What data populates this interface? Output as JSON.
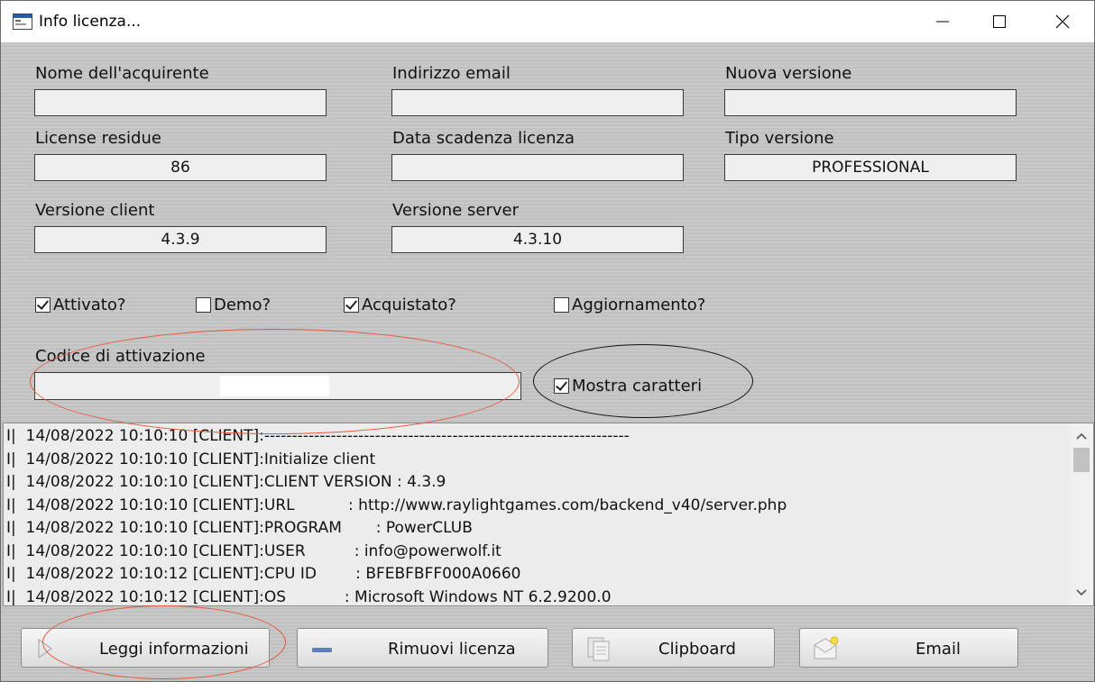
{
  "window": {
    "title": "Info licenza..."
  },
  "fields": {
    "buyer_name": {
      "label": "Nome dell'acquirente",
      "value": ""
    },
    "email": {
      "label": "Indirizzo email",
      "value": ""
    },
    "new_version": {
      "label": "Nuova versione",
      "value": ""
    },
    "licenses_left": {
      "label": "License residue",
      "value": "86"
    },
    "expiry_date": {
      "label": "Data scadenza licenza",
      "value": ""
    },
    "version_type": {
      "label": "Tipo versione",
      "value": "PROFESSIONAL"
    },
    "client_version": {
      "label": "Versione client",
      "value": "4.3.9"
    },
    "server_version": {
      "label": "Versione server",
      "value": "4.3.10"
    }
  },
  "checkboxes": {
    "activated": {
      "label": "Attivato?",
      "checked": true
    },
    "demo": {
      "label": "Demo?",
      "checked": false
    },
    "purchased": {
      "label": "Acquistato?",
      "checked": true
    },
    "update": {
      "label": "Aggiornamento?",
      "checked": false
    },
    "show_chars": {
      "label": "Mostra caratteri",
      "checked": true
    }
  },
  "activation": {
    "label": "Codice di attivazione",
    "value": ""
  },
  "log": {
    "lines": [
      "I|  14/08/2022 10:10:10 [CLIENT]:------------------------------------------------------------------",
      "I|  14/08/2022 10:10:10 [CLIENT]:Initialize client",
      "I|  14/08/2022 10:10:10 [CLIENT]:CLIENT VERSION : 4.3.9",
      "I|  14/08/2022 10:10:10 [CLIENT]:URL           : http://www.raylightgames.com/backend_v40/server.php",
      "I|  14/08/2022 10:10:10 [CLIENT]:PROGRAM       : PowerCLUB",
      "I|  14/08/2022 10:10:10 [CLIENT]:USER          : info@powerwolf.it",
      "I|  14/08/2022 10:10:12 [CLIENT]:CPU ID        : BFEBFBFF000A0660",
      "I|  14/08/2022 10:10:12 [CLIENT]:OS            : Microsoft Windows NT 6.2.9200.0"
    ]
  },
  "buttons": {
    "read_info": "Leggi informazioni",
    "remove_license": "Rimuovi licenza",
    "clipboard": "Clipboard",
    "email": "Email"
  },
  "colors": {
    "annotation_red": "#e2593a",
    "annotation_black": "#111111"
  }
}
